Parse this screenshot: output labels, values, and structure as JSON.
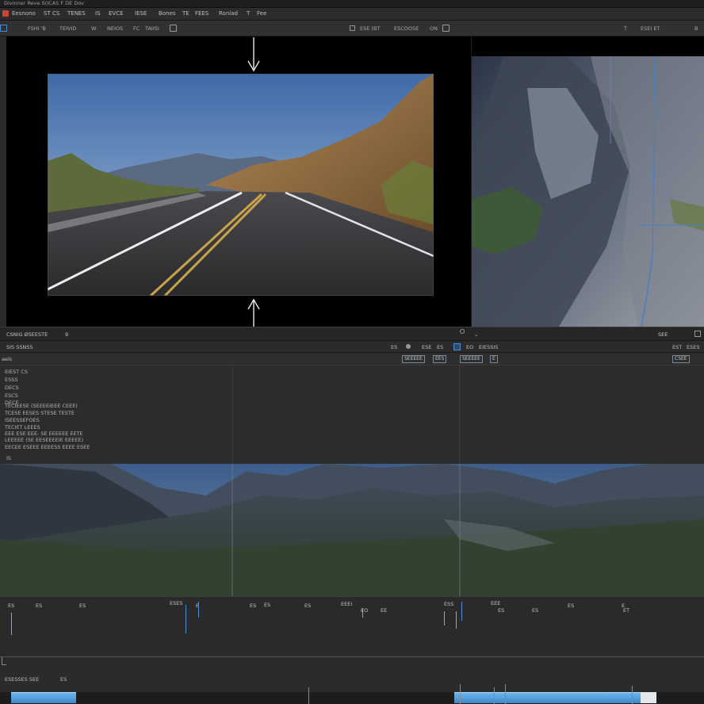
{
  "app": {
    "title": "Divinner Reve S(ICAS F DE Dov"
  },
  "menubar": {
    "items": [
      "Eesnono",
      "ST CS",
      "TENES",
      "IS",
      "EVCE",
      "IESE",
      "Bones",
      "TE",
      "FEES",
      "Ronlad",
      "T",
      "Fee"
    ]
  },
  "toolbar": {
    "left_items": [
      "FSHI 'B",
      "TEIVID",
      "W",
      "NEIOS",
      "FC",
      "TAIISI"
    ],
    "center_items": [
      "ESE (BT",
      "ESCOOSE",
      "ON"
    ],
    "right_items": [
      "T",
      "ESEI ET",
      "B"
    ]
  },
  "viewer_bar": {
    "left_label": "CSNIG ØSEESTE",
    "left_value": "9",
    "right_label": "SEE"
  },
  "timeline_header": {
    "left_label": "SIS SSNSS",
    "center_items": [
      "ES",
      "ESE",
      "ES",
      "EO",
      "EIESSIS"
    ],
    "right_items": [
      "EST",
      "ESES"
    ]
  },
  "timeline_toolbar": {
    "left_label": "aels",
    "buttons": [
      "SEEEEE",
      "EES",
      "SEEEEE",
      "E"
    ],
    "right_label": "CSEE"
  },
  "inspector": {
    "lines": [
      "EIEST CS",
      "ESSS",
      "DECS",
      "ESCS",
      "DECE",
      "TECIEESE (SEEEEIEEE CEEE)",
      "TCESE EESES STESE TESTE",
      "ISEESSEFOES",
      "TECIET LEEES",
      "EEE ESE EEE: SE EEEEEE EETE",
      "LEEEEE (SE EESEEEEIE EEEEE)",
      "EECEE ESEEE EEEESS EEEE ESEE"
    ],
    "footer": "IS"
  },
  "ruler": {
    "labels": [
      "ES",
      "ES",
      "ES",
      "ESES",
      "E",
      "ES",
      "ES",
      "ES",
      "EEEI",
      "EO",
      "EE",
      "ESS",
      "EEE",
      "ES",
      "ES",
      "ES",
      "E",
      "ET"
    ]
  },
  "bottom_panel": {
    "label": "ESESSES SEE",
    "value": "ES"
  },
  "colors": {
    "accent": "#4a90d9",
    "clip": "#5aa8e4",
    "background": "#2a2a2b"
  }
}
